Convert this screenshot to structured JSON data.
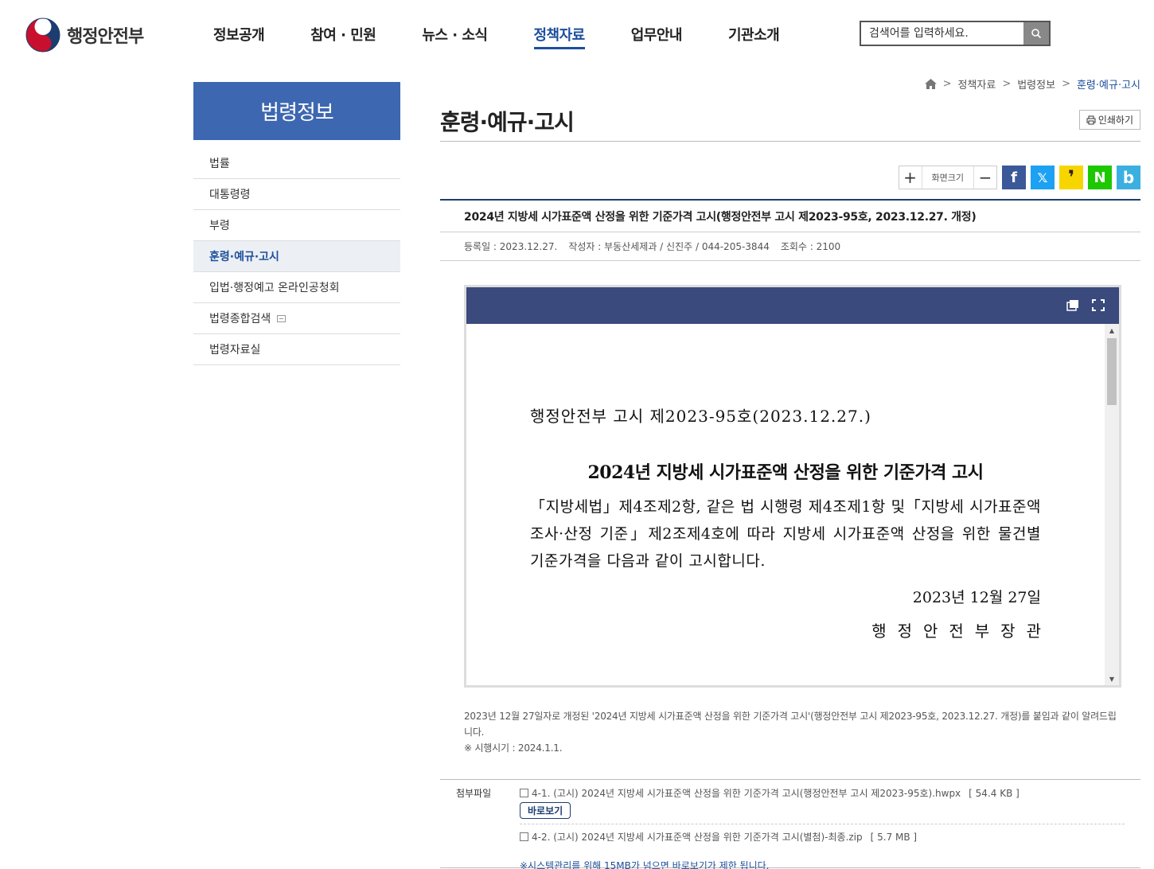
{
  "header": {
    "logo_text": "행정안전부",
    "nav": [
      "정보공개",
      "참여 · 민원",
      "뉴스 · 소식",
      "정책자료",
      "업무안내",
      "기관소개"
    ],
    "nav_active_index": 3,
    "search_placeholder": "검색어를 입력하세요."
  },
  "sidebar": {
    "title": "법령정보",
    "items": [
      "법률",
      "대통령령",
      "부령",
      "훈령·예규·고시",
      "입법·행정예고 온라인공청회",
      "법령종합검색",
      "법령자료실"
    ],
    "active_index": 3
  },
  "breadcrumb": [
    "정책자료",
    "법령정보",
    "훈령·예규·고시"
  ],
  "page": {
    "title": "훈령·예규·고시",
    "print_label": "인쇄하기",
    "zoom_label": "화면크기",
    "zoom_in": "+",
    "zoom_out": "−"
  },
  "sns": [
    {
      "name": "facebook",
      "glyph": "f",
      "color": "#3b5998"
    },
    {
      "name": "x",
      "glyph": "𝕏",
      "color": "#1da1f2"
    },
    {
      "name": "kakaostory",
      "glyph": "❜",
      "color": "#f7d600"
    },
    {
      "name": "naver",
      "glyph": "N",
      "color": "#1ec800"
    },
    {
      "name": "band",
      "glyph": "b",
      "color": "#3bb0e0"
    }
  ],
  "post": {
    "title": "2024년 지방세 시가표준액 산정을 위한 기준가격 고시(행정안전부 고시 제2023-95호, 2023.12.27. 개정)",
    "registered": "등록일 : 2023.12.27.",
    "author": "작성자 : 부동산세제과 / 신진주 / 044-205-3844",
    "views": "조회수 : 2100"
  },
  "document": {
    "number": "행정안전부 고시 제2023-95호(2023.12.27.)",
    "title": "2024년 지방세 시가표준액 산정을 위한 기준가격 고시",
    "body": "「지방세법」제4조제2항, 같은 법 시행령 제4조제1항 및「지방세 시가표준액 조사·산정 기준」제2조제4호에 따라 지방세 시가표준액 산정을 위한 물건별 기준가격을 다음과 같이 고시합니다.",
    "date": "2023년 12월 27일",
    "signature": "행정안전부장관"
  },
  "notice": {
    "text": "2023년 12월 27일자로 개정된 '2024년 지방세 시가표준액 산정을 위한 기준가격 고시'(행정안전부 고시 제2023-95호, 2023.12.27. 개정)를 붙임과 같이 알려드립니다.",
    "effective": "※ 시행시기 : 2024.1.1."
  },
  "attachments": {
    "label": "첨부파일",
    "files": [
      {
        "name": "4-1. (고시) 2024년 지방세 시가표준액 산정을 위한 기준가격 고시(행정안전부 고시 제2023-95호).hwpx",
        "size": "[ 54.4 KB ]",
        "view_label": "바로보기"
      },
      {
        "name": "4-2. (고시) 2024년 지방세 시가표준액 산정을 위한 기준가격 고시(별첨)-최종.zip",
        "size": "[ 5.7 MB ]"
      }
    ],
    "warning": "※시스템관리를 위해 15MB가 넘으면 바로보기가 제한 됩니다."
  }
}
